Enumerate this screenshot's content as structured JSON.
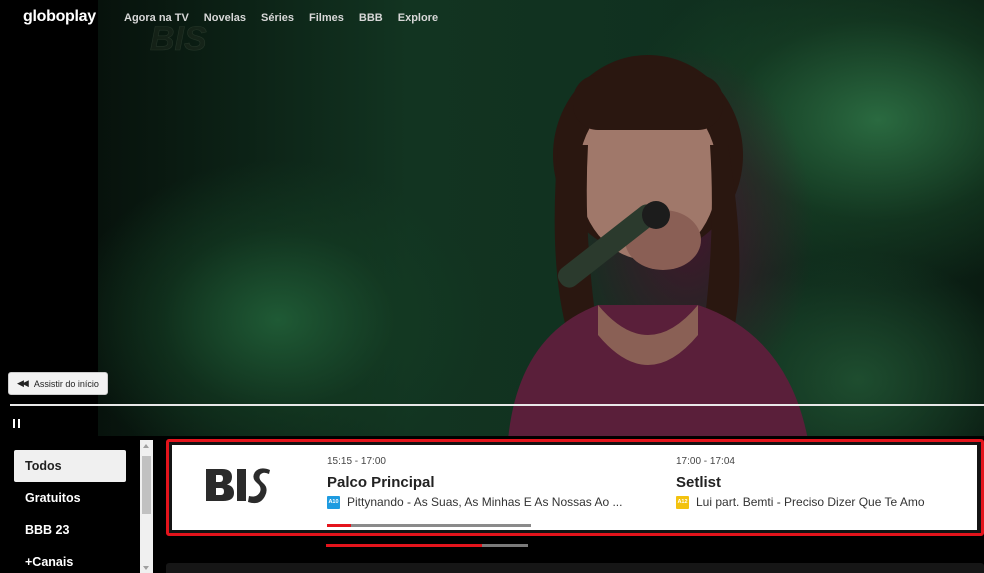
{
  "app": {
    "brand": "globoplay"
  },
  "nav": {
    "items": [
      {
        "label": "Agora na TV"
      },
      {
        "label": "Novelas"
      },
      {
        "label": "Séries"
      },
      {
        "label": "Filmes"
      },
      {
        "label": "BBB"
      },
      {
        "label": "Explore"
      }
    ]
  },
  "player": {
    "restart_label": "Assistir do início",
    "restart_icon": "rewind-icon",
    "pause_icon": "pause-icon",
    "channel_watermark": "BIS"
  },
  "categories": [
    {
      "label": "Todos",
      "active": true
    },
    {
      "label": "Gratuitos",
      "active": false
    },
    {
      "label": "BBB 23",
      "active": false
    },
    {
      "label": "+Canais",
      "active": false
    }
  ],
  "channel": {
    "name": "BIS",
    "current": {
      "time": "15:15 - 17:00",
      "title": "Palco Principal",
      "episode": "Pittynando - As Suas, As Minhas E As Nossas Ao ...",
      "rating": "A10",
      "rating_color": "#1e9be0",
      "progress": 0.12
    },
    "next": {
      "time": "17:00 - 17:04",
      "title": "Setlist",
      "episode": "Lui part. Bemti - Preciso Dizer Que Te Amo",
      "rating": "A12",
      "rating_color": "#f3c20f"
    },
    "carousel_progress": 0.77
  },
  "colors": {
    "accent": "#e4141c",
    "background": "#000000"
  }
}
